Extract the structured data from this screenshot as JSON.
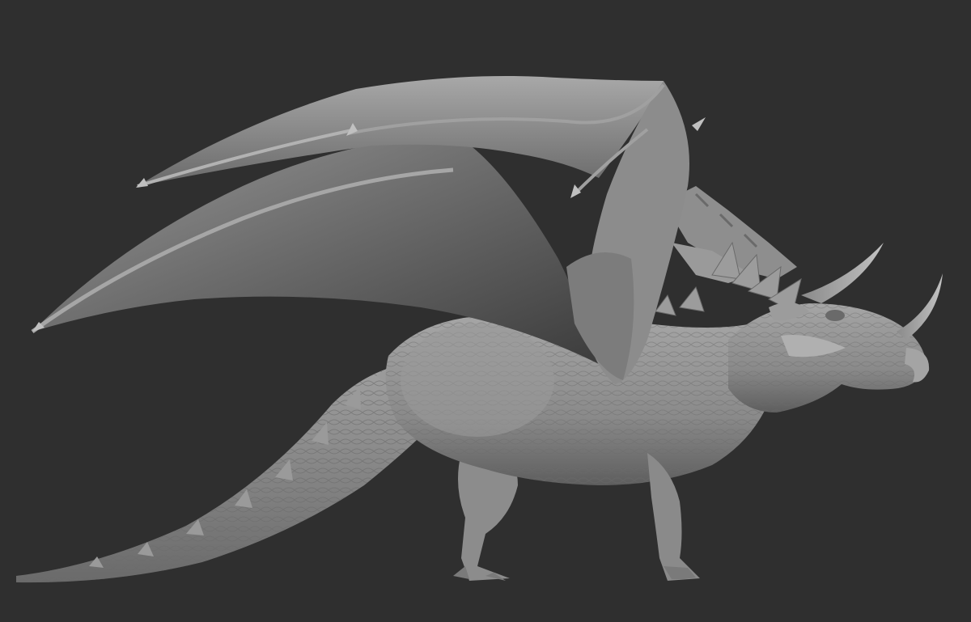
{
  "scene": {
    "background_color": "#2f2f2f",
    "subject": "dragon-sculpt",
    "material_color": "#8a8a8a",
    "shadow_color": "#3a3a3a",
    "highlight_color": "#b4b4b4"
  }
}
